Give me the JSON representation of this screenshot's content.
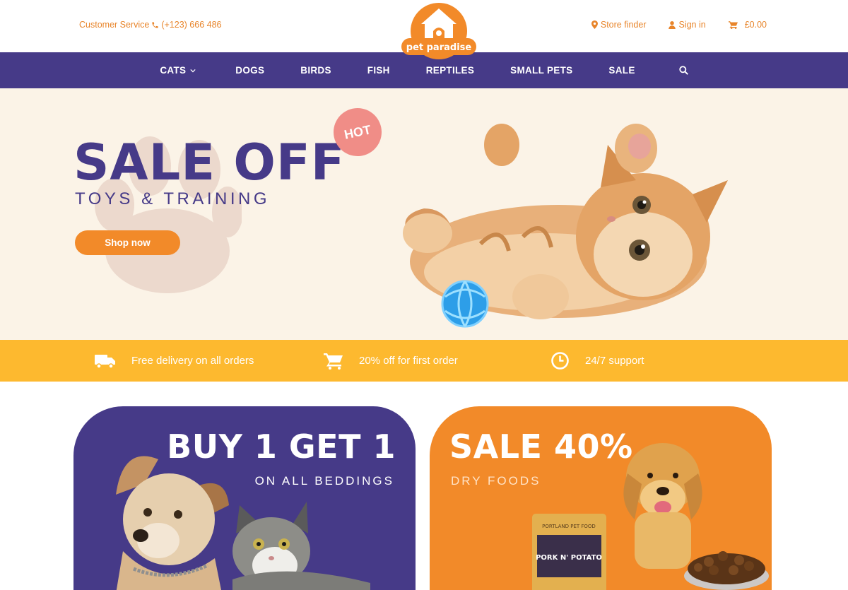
{
  "topbar": {
    "customer_service_label": "Customer Service",
    "phone": "(+123) 666 486",
    "store_finder": "Store finder",
    "sign_in": "Sign in",
    "cart_total": "£0.00"
  },
  "logo": {
    "text": "pet paradise"
  },
  "nav": {
    "items": [
      "CATS",
      "DOGS",
      "BIRDS",
      "FISH",
      "REPTILES",
      "SMALL PETS",
      "SALE"
    ]
  },
  "hero": {
    "title": "SALE OFF",
    "subtitle": "TOYS & TRAINING",
    "badge": "HOT",
    "button": "Shop now"
  },
  "features": [
    {
      "icon": "truck-icon",
      "text": "Free delivery on all orders"
    },
    {
      "icon": "cart-icon",
      "text": "20% off for first order"
    },
    {
      "icon": "clock-icon",
      "text": "24/7 support"
    }
  ],
  "promos": [
    {
      "title": "BUY 1 GET 1",
      "subtitle": "ON ALL BEDDINGS"
    },
    {
      "title": "SALE 40%",
      "subtitle": "DRY FOODS",
      "product_brand": "PORTLAND PET FOOD",
      "product_name": "PORK N' POTATO"
    }
  ],
  "colors": {
    "brand_purple": "#463a88",
    "brand_orange": "#f28a29",
    "feature_yellow": "#fdb92f",
    "hero_bg": "#fbf3e7",
    "hot_pink": "#f08d87"
  }
}
